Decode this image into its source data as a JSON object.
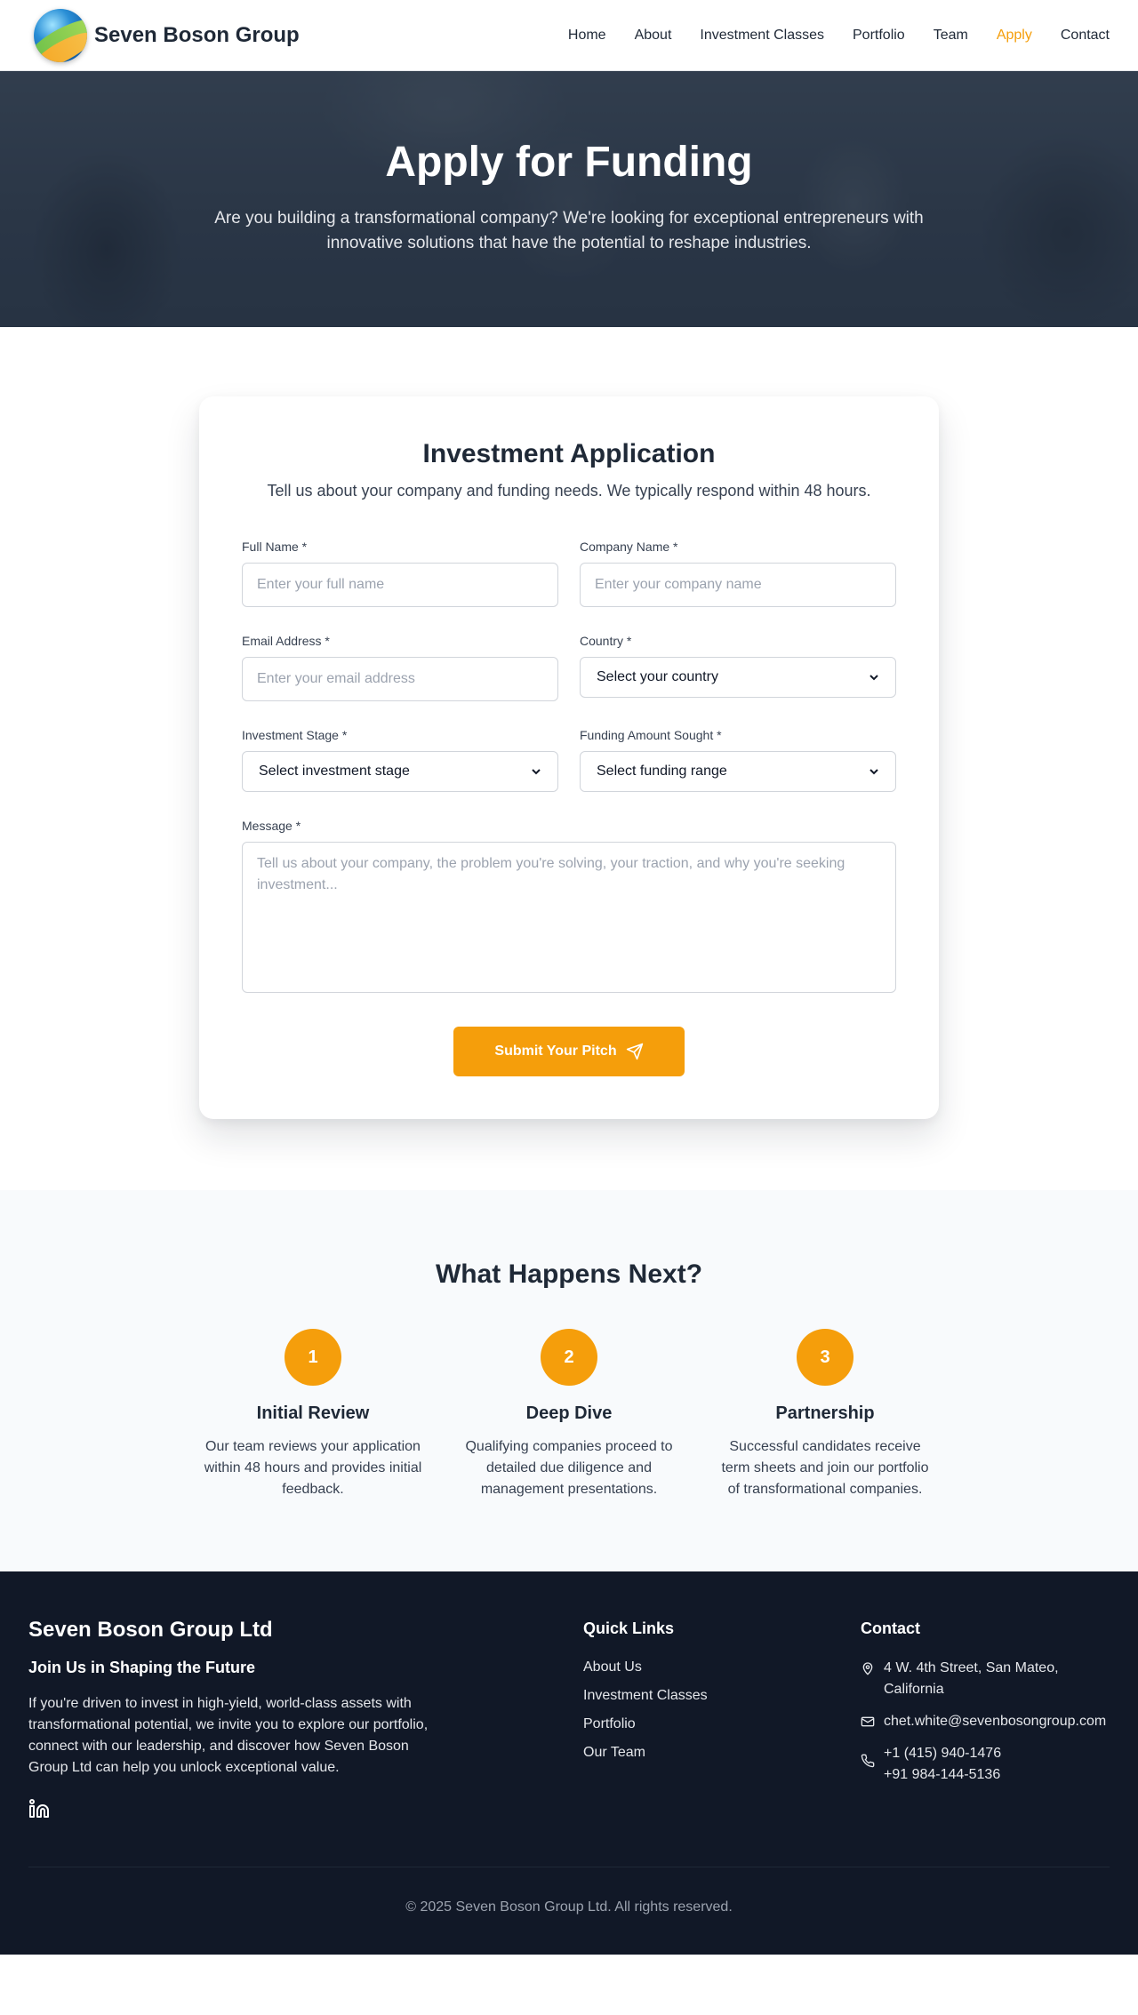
{
  "nav": {
    "brand": "Seven Boson Group",
    "links": [
      {
        "label": "Home"
      },
      {
        "label": "About"
      },
      {
        "label": "Investment Classes"
      },
      {
        "label": "Portfolio"
      },
      {
        "label": "Team"
      },
      {
        "label": "Apply"
      },
      {
        "label": "Contact"
      }
    ],
    "active": "Apply",
    "accent_color": "#f59e0b"
  },
  "hero": {
    "title": "Apply for Funding",
    "subtitle": "Are you building a transformational company? We're looking for exceptional entrepreneurs with innovative solutions that have the potential to reshape industries."
  },
  "form": {
    "title": "Investment Application",
    "subtitle": "Tell us about your company and funding needs. We typically respond within 48 hours.",
    "full_name": {
      "label": "Full Name *",
      "placeholder": "Enter your full name"
    },
    "company_name": {
      "label": "Company Name *",
      "placeholder": "Enter your company name"
    },
    "email": {
      "label": "Email Address *",
      "placeholder": "Enter your email address"
    },
    "country": {
      "label": "Country *",
      "selected": "Select your country"
    },
    "stage": {
      "label": "Investment Stage *",
      "selected": "Select investment stage"
    },
    "funding": {
      "label": "Funding Amount Sought *",
      "selected": "Select funding range"
    },
    "message": {
      "label": "Message *",
      "placeholder": "Tell us about your company, the problem you're solving, your traction, and why you're seeking investment..."
    },
    "submit_label": "Submit Your Pitch",
    "submit_icon": "send-icon"
  },
  "next": {
    "title": "What Happens Next?",
    "steps": [
      {
        "number": "1",
        "title": "Initial Review",
        "text": "Our team reviews your application within 48 hours and provides initial feedback."
      },
      {
        "number": "2",
        "title": "Deep Dive",
        "text": "Qualifying companies proceed to detailed due diligence and management presentations."
      },
      {
        "number": "3",
        "title": "Partnership",
        "text": "Successful candidates receive term sheets and join our portfolio of transformational companies."
      }
    ]
  },
  "footer": {
    "company": "Seven Boson Group Ltd",
    "tagline": "Join Us in Shaping the Future",
    "description": "If you're driven to invest in high-yield, world-class assets with transformational potential, we invite you to explore our portfolio, connect with our leadership, and discover how Seven Boson Group Ltd can help you unlock exceptional value.",
    "social_icon": "linkedin-icon",
    "quick_links_title": "Quick Links",
    "quick_links": [
      {
        "label": "About Us"
      },
      {
        "label": "Investment Classes"
      },
      {
        "label": "Portfolio"
      },
      {
        "label": "Our Team"
      }
    ],
    "contact_title": "Contact",
    "address": "4 W. 4th Street, San Mateo, California",
    "email": "chet.white@sevenbosongroup.com",
    "phone1": "+1 (415) 940-1476",
    "phone2": "+91 984-144-5136",
    "copyright": "© 2025 Seven Boson Group Ltd. All rights reserved."
  }
}
